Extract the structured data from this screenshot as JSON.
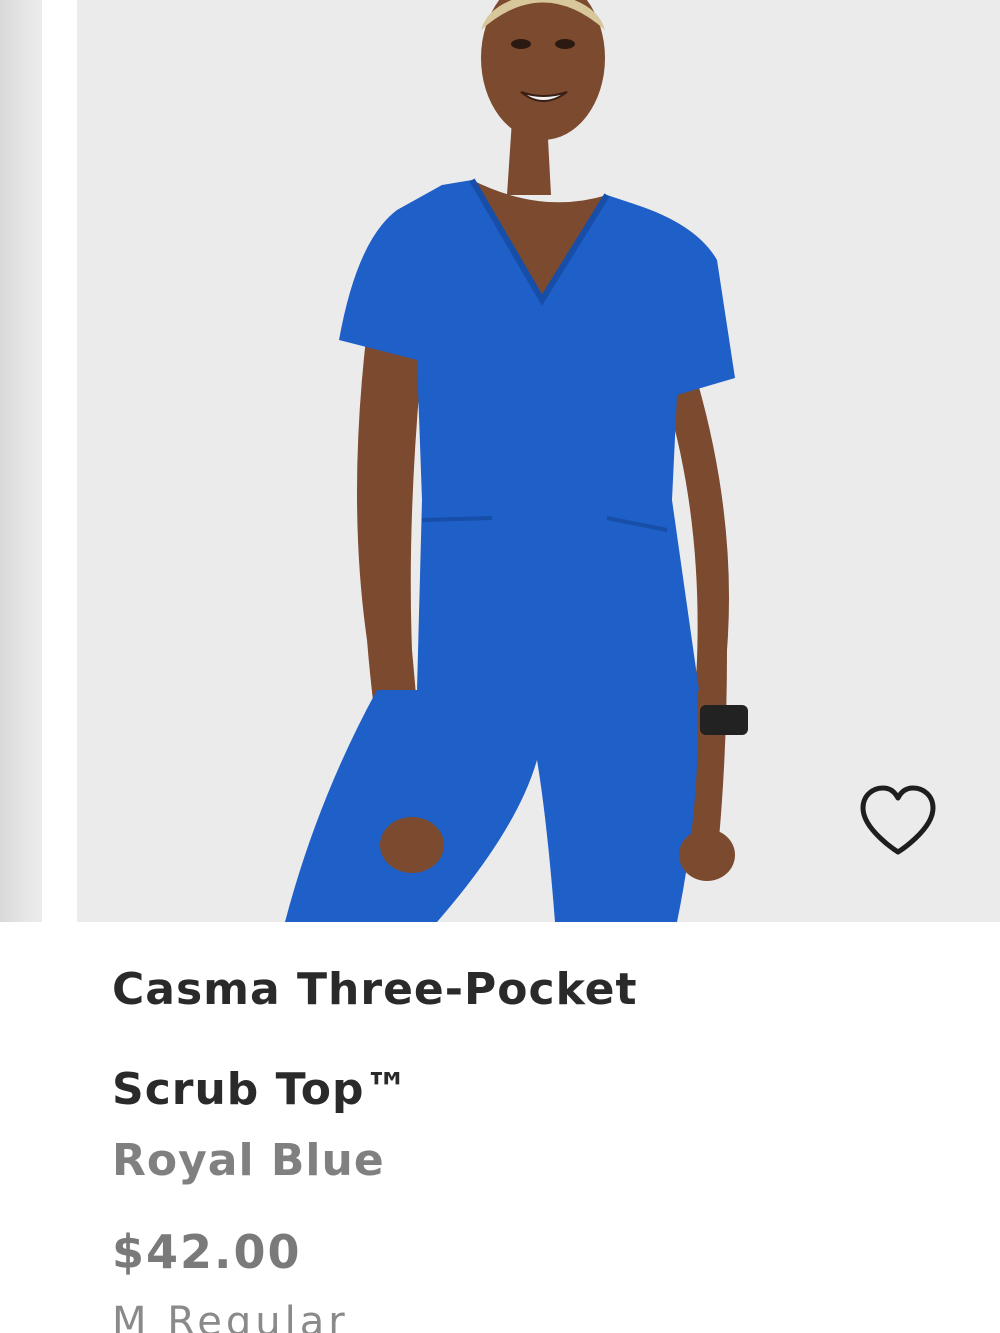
{
  "product": {
    "name_line1": "Casma Three-Pocket",
    "name_line2": "Scrub Top™",
    "color_name": "Royal Blue",
    "price": "$42.00",
    "size_fit": "M Regular"
  },
  "icons": {
    "favorite": "heart-outline-icon"
  },
  "colors": {
    "scrub": "#1f5fc8",
    "title_text": "#2a2a2a",
    "secondary_text": "#808080",
    "image_background": "#ebebec"
  }
}
